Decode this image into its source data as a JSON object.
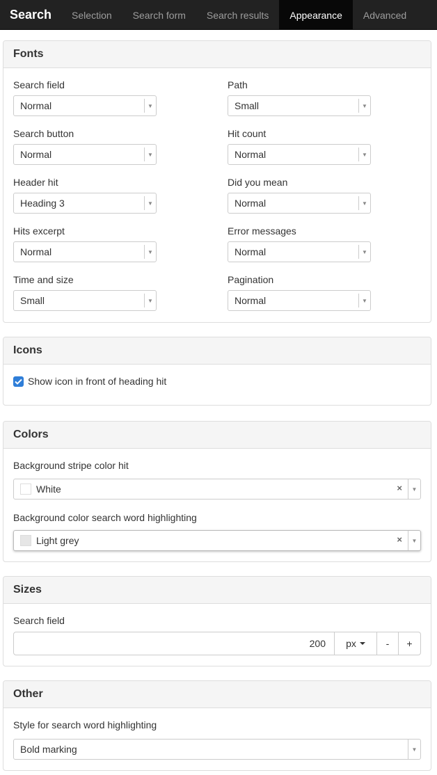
{
  "nav": {
    "brand": "Search",
    "tabs": [
      {
        "label": "Selection"
      },
      {
        "label": "Search form"
      },
      {
        "label": "Search results"
      },
      {
        "label": "Appearance"
      },
      {
        "label": "Advanced"
      }
    ],
    "active_tab": "Appearance"
  },
  "fonts": {
    "title": "Fonts",
    "fields": [
      {
        "label": "Search field",
        "value": "Normal"
      },
      {
        "label": "Path",
        "value": "Small"
      },
      {
        "label": "Search button",
        "value": "Normal"
      },
      {
        "label": "Hit count",
        "value": "Normal"
      },
      {
        "label": "Header hit",
        "value": "Heading 3"
      },
      {
        "label": "Did you mean",
        "value": "Normal"
      },
      {
        "label": "Hits excerpt",
        "value": "Normal"
      },
      {
        "label": "Error messages",
        "value": "Normal"
      },
      {
        "label": "Time and size",
        "value": "Small"
      },
      {
        "label": "Pagination",
        "value": "Normal"
      }
    ]
  },
  "icons": {
    "title": "Icons",
    "checkbox_label": "Show icon in front of heading hit",
    "checked": true
  },
  "colors": {
    "title": "Colors",
    "stripe": {
      "label": "Background stripe color hit",
      "value": "White",
      "swatch": "#ffffff"
    },
    "highlight": {
      "label": "Background color search word highlighting",
      "value": "Light grey",
      "swatch": "#e6e6e6"
    },
    "clear_glyph": "×"
  },
  "sizes": {
    "title": "Sizes",
    "label": "Search field",
    "value": "200",
    "unit": "px",
    "minus": "-",
    "plus": "+"
  },
  "other": {
    "title": "Other",
    "label": "Style for search word highlighting",
    "value": "Bold marking"
  },
  "theme": {
    "navbar_bg": "#222222",
    "accent": "#2f7ed8"
  }
}
